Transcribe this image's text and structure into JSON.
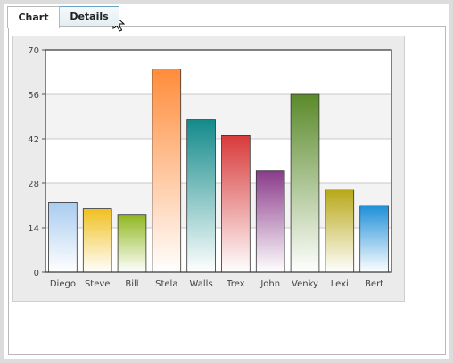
{
  "tabs": [
    {
      "label": "Chart",
      "active": true
    },
    {
      "label": "Details",
      "active": false
    }
  ],
  "chart_data": {
    "type": "bar",
    "categories": [
      "Diego",
      "Steve",
      "Bill",
      "Stela",
      "Walls",
      "Trex",
      "John",
      "Venky",
      "Lexi",
      "Bert"
    ],
    "values": [
      22,
      20,
      18,
      64,
      48,
      43,
      32,
      56,
      26,
      21
    ],
    "ylim": [
      0,
      70
    ],
    "yticks": [
      "0",
      "14",
      "28",
      "42",
      "56",
      "70"
    ],
    "grid": true,
    "colors": [
      "#a9ccf0",
      "#f0c020",
      "#90b820",
      "#ff8c3a",
      "#138a8a",
      "#d83a3a",
      "#8a3a8a",
      "#5a8a2a",
      "#b8a818",
      "#1e8fd8"
    ]
  }
}
